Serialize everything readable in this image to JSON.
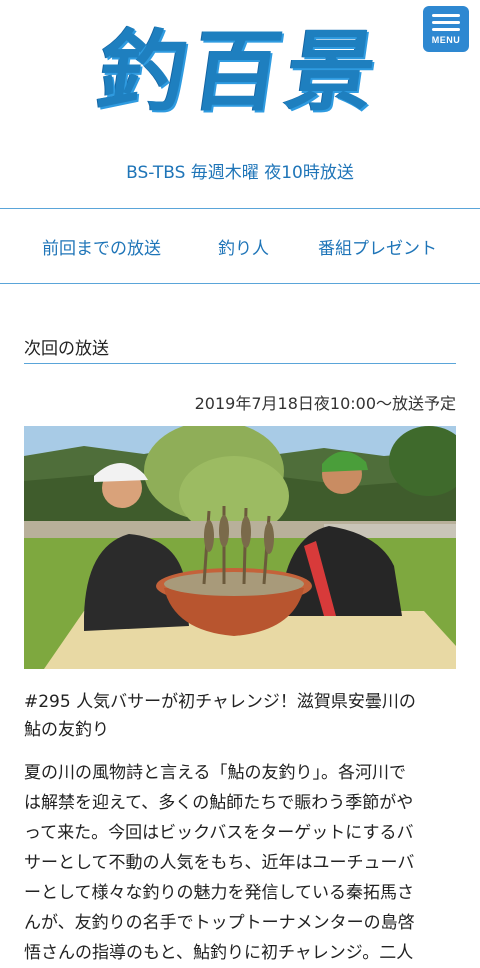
{
  "header": {
    "logo_text": "釣百景",
    "menu_label": "MENU",
    "tagline": "BS-TBS 毎週木曜 夜10時放送"
  },
  "nav": {
    "items": [
      {
        "label": "前回までの放送"
      },
      {
        "label": "釣り人"
      },
      {
        "label": "番組プレゼント"
      }
    ]
  },
  "next": {
    "section_title": "次回の放送",
    "air_date": "2019年7月18日夜10:00〜放送予定",
    "episode_title_lines": [
      "#295 人気バサーが初チャレンジ！滋賀県安曇川の",
      "鮎の友釣り"
    ],
    "description_lines": [
      "夏の川の風物詩と言える「鮎の友釣り」。各河川で",
      "は解禁を迎えて、多くの鮎師たちで賑わう季節がや",
      "って来た。今回はビックバスをターゲットにするバ",
      "サーとして不動の人気をもち、近年はユーチューバ",
      "ーとして様々な釣りの魅力を発信している秦拓馬さ",
      "んが、友釣りの名手でトップトーナメンターの島啓",
      "悟さんの指導のもと、鮎釣りに初チャレンジ。二人"
    ]
  },
  "colors": {
    "brand_blue": "#1e7fbf",
    "link_blue": "#1f75b8",
    "divider_blue": "#5aa5d9",
    "menu_bg": "#2e88d1"
  },
  "icons": {
    "menu": "hamburger-icon"
  }
}
